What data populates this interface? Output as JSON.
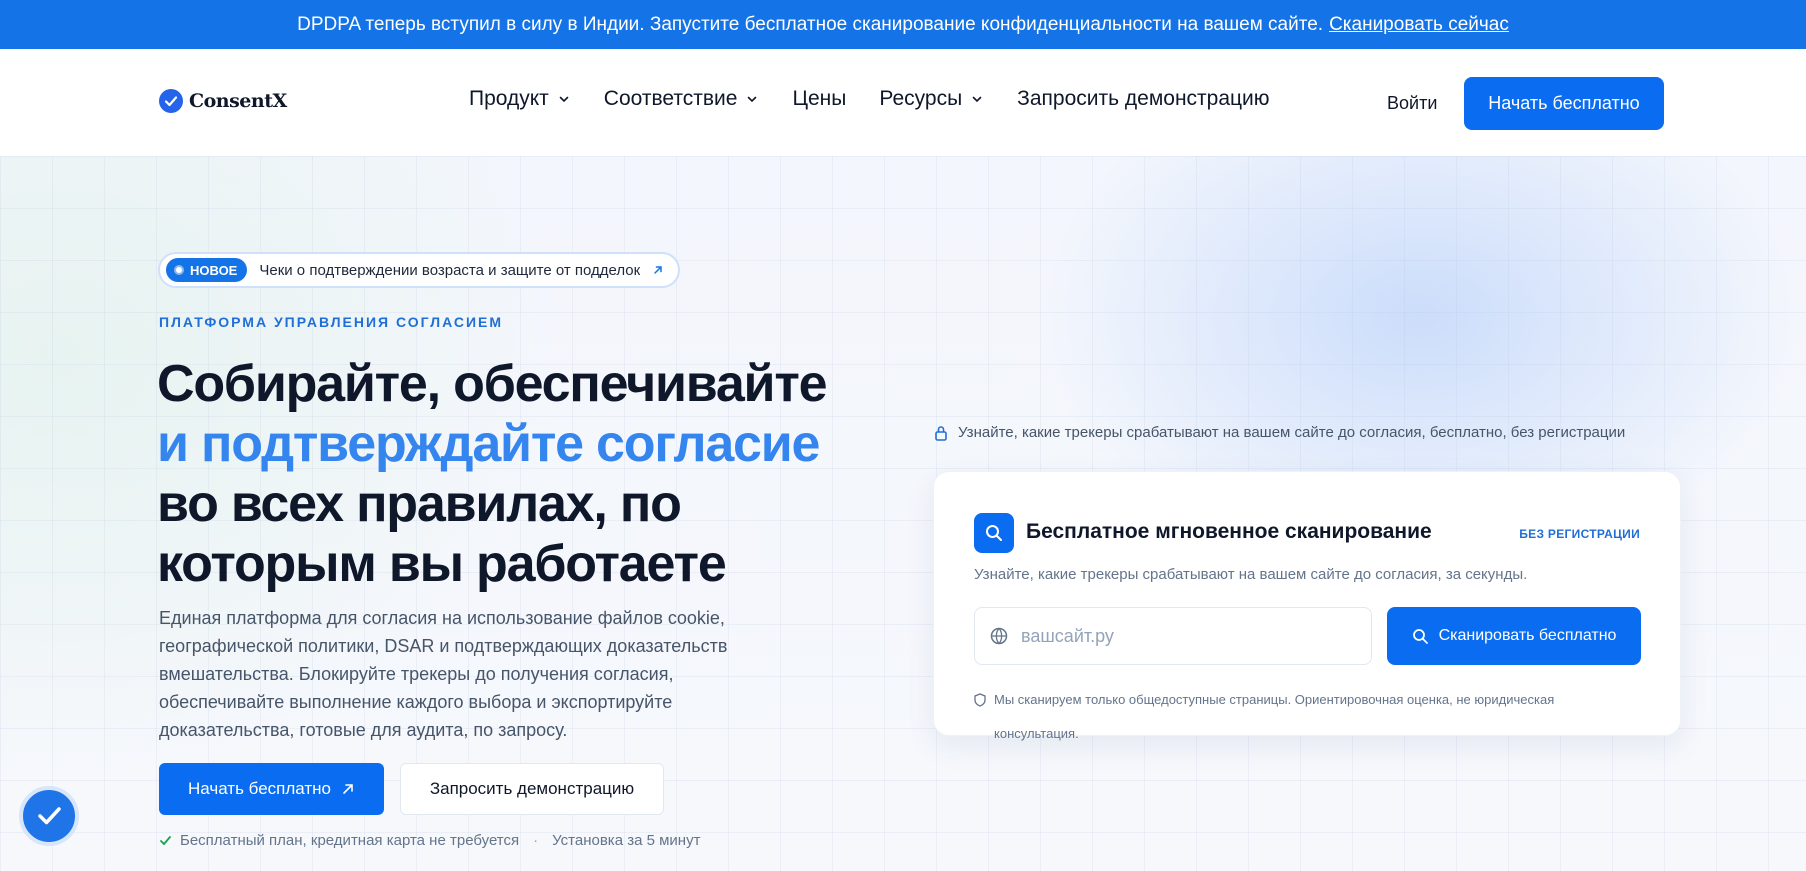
{
  "announcement": {
    "text": "DPDPA теперь вступил в силу в Индии. Запустите бесплатное сканирование конфиденциальности на вашем сайте.",
    "link": "Сканировать сейчас"
  },
  "nav": {
    "logo": "ConsentX",
    "items": [
      {
        "label": "Продукт",
        "dropdown": true
      },
      {
        "label": "Соответствие",
        "dropdown": true
      },
      {
        "label": "Цены",
        "dropdown": false
      },
      {
        "label": "Ресурсы",
        "dropdown": true
      },
      {
        "label": "Запросить демонстрацию",
        "dropdown": false
      }
    ],
    "login": "Войти",
    "cta": "Начать бесплатно"
  },
  "hero": {
    "pill_badge": "НОВОЕ",
    "pill_text": "Чеки о подтверждении возраста и защите от подделок",
    "eyebrow": "ПЛАТФОРМА УПРАВЛЕНИЯ СОГЛАСИЕМ",
    "headline_1": "Собирайте, обеспечивайте",
    "headline_accent": "и подтверждайте согласие",
    "headline_2": "во всех правилах, по",
    "headline_3": "которым вы работаете",
    "lead": "Единая платформа для согласия на использование файлов cookie, географической политики, DSAR и подтверждающих доказательств вмешательства. Блокируйте трекеры до получения согласия, обеспечивайте выполнение каждого выбора и экспортируйте доказательства, готовые для аудита, по запросу.",
    "primary_button": "Начать бесплатно",
    "secondary_button": "Запросить демонстрацию",
    "assurance_1": "Бесплатный план, кредитная карта не требуется",
    "assurance_2": "Установка за 5 минут"
  },
  "scan": {
    "note": "Узнайте, какие трекеры срабатывают на вашем сайте до согласия, бесплатно, без регистрации",
    "title": "Бесплатное мгновенное сканирование",
    "tag": "БЕЗ РЕГИСТРАЦИИ",
    "subtitle": "Узнайте, какие трекеры срабатывают на вашем сайте до согласия, за секунды.",
    "input_placeholder": "вашсайт.ру",
    "input_value": "",
    "button": "Сканировать бесплатно",
    "disclaimer": "Мы сканируем только общедоступные страницы. Ориентировочная оценка, не юридическая консультация."
  },
  "colors": {
    "brand": "#0a6cf0",
    "accent_text": "#3585ee",
    "announcement_bg": "#1473e6"
  }
}
